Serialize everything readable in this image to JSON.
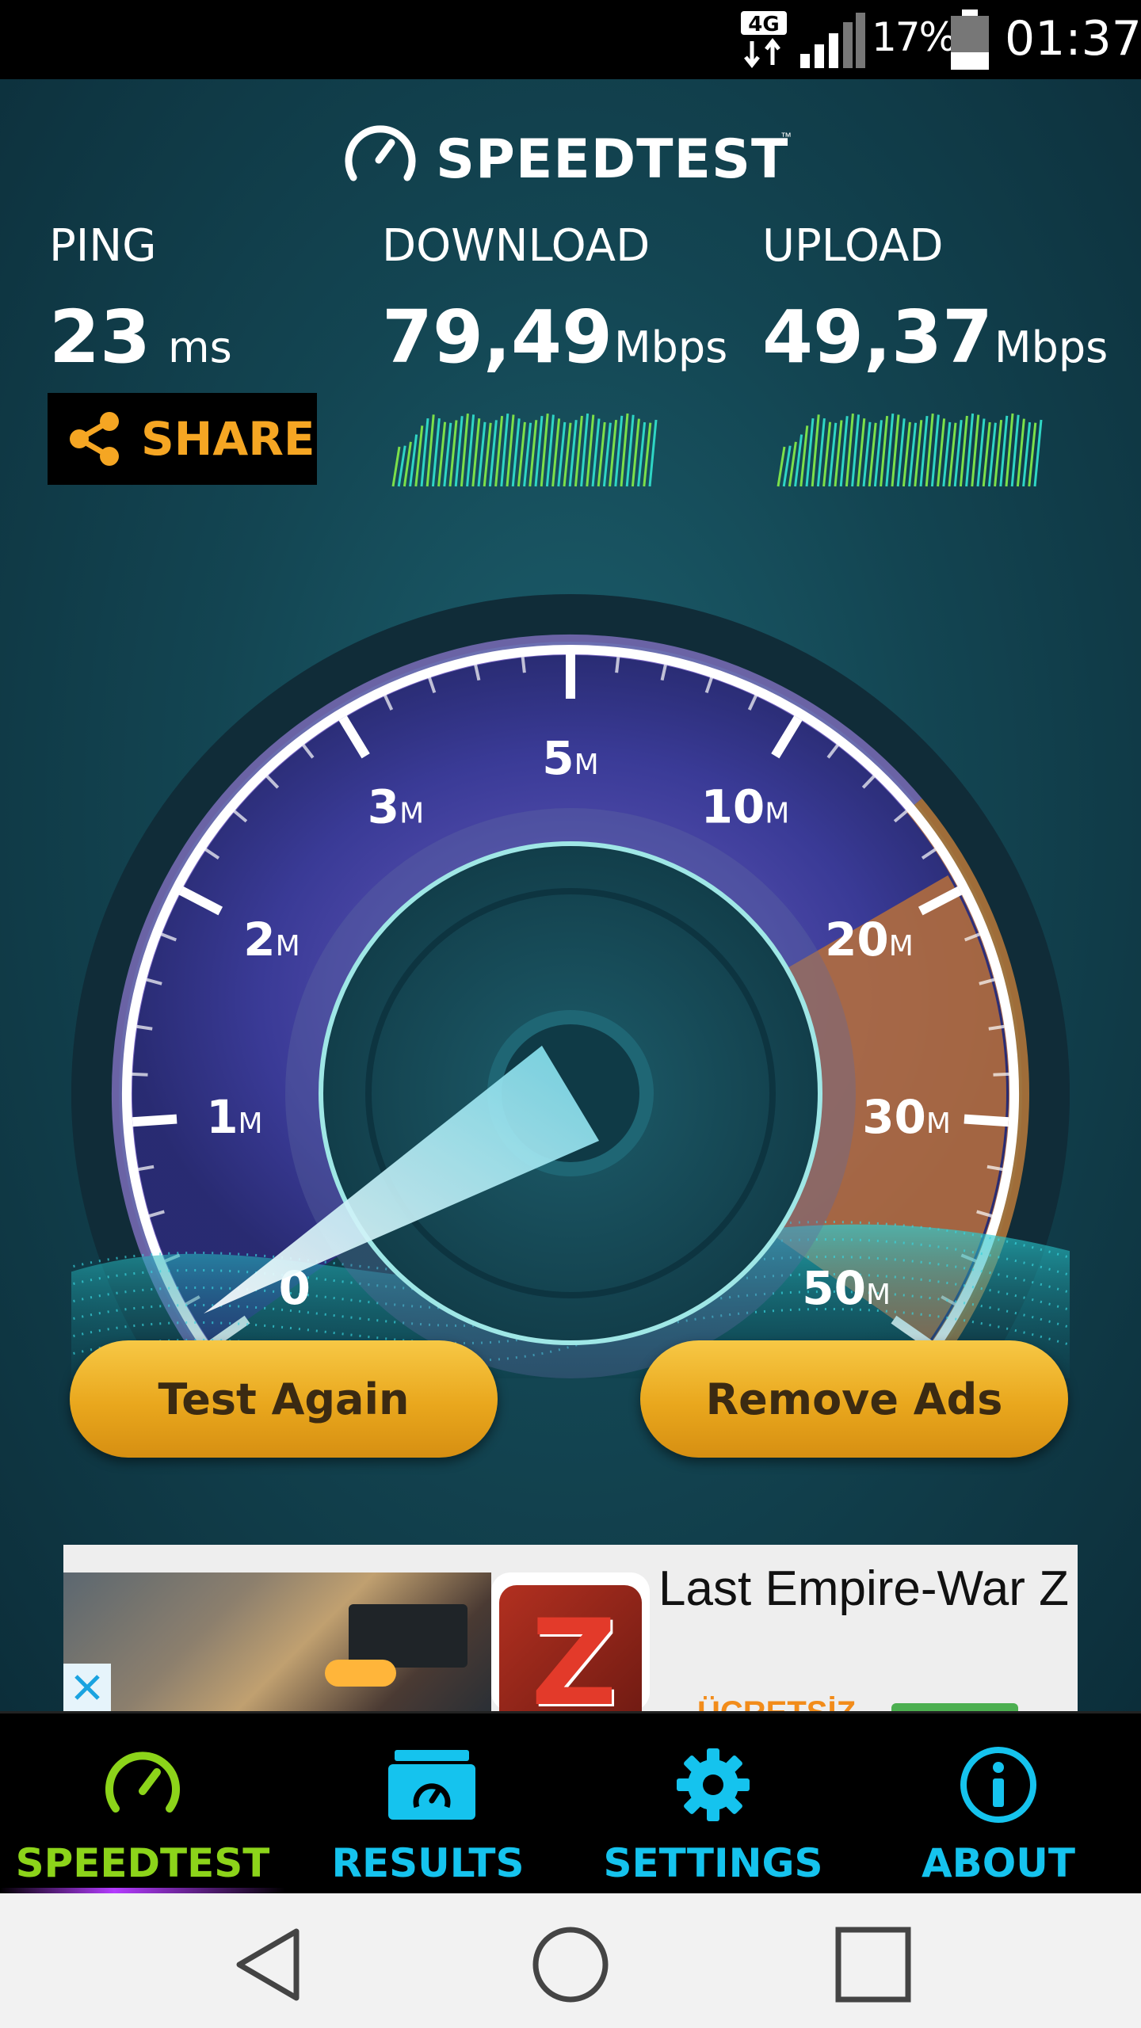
{
  "status_bar": {
    "network": "4G",
    "battery_percent": "17%",
    "time": "01:37"
  },
  "header": {
    "app_name": "SPEEDTEST",
    "trademark": "™"
  },
  "metrics": {
    "ping": {
      "label": "PING",
      "value": "23",
      "unit": "ms"
    },
    "download": {
      "label": "DOWNLOAD",
      "value": "79,49",
      "unit": "Mbps"
    },
    "upload": {
      "label": "UPLOAD",
      "value": "49,37",
      "unit": "Mbps"
    }
  },
  "share": {
    "label": "SHARE"
  },
  "gauge": {
    "ticks": [
      {
        "num": "0",
        "suffix": ""
      },
      {
        "num": "1",
        "suffix": "M"
      },
      {
        "num": "2",
        "suffix": "M"
      },
      {
        "num": "3",
        "suffix": "M"
      },
      {
        "num": "5",
        "suffix": "M"
      },
      {
        "num": "10",
        "suffix": "M"
      },
      {
        "num": "20",
        "suffix": "M"
      },
      {
        "num": "30",
        "suffix": "M"
      },
      {
        "num": "50",
        "suffix": "M"
      }
    ],
    "colors": {
      "arc": "#ffffff",
      "glow_low": "#9a6cff",
      "glow_high": "#ff8a2a",
      "needle": "#9ff6ff"
    }
  },
  "buttons": {
    "test_again": "Test Again",
    "remove_ads": "Remove Ads"
  },
  "ad": {
    "title": "Last Empire-War Z",
    "app_icon_letter": "Z",
    "cta": "ÜCRETSİZ"
  },
  "tabs": [
    {
      "label": "SPEEDTEST",
      "icon": "speedometer-icon",
      "active": true
    },
    {
      "label": "RESULTS",
      "icon": "results-folder-icon",
      "active": false
    },
    {
      "label": "SETTINGS",
      "icon": "gear-icon",
      "active": false
    },
    {
      "label": "ABOUT",
      "icon": "info-icon",
      "active": false
    }
  ],
  "colors": {
    "active_tab": "#8cd41a",
    "inactive_tab": "#15c3ee",
    "share_text": "#f5a623",
    "button_gold": "#e9a71d"
  }
}
